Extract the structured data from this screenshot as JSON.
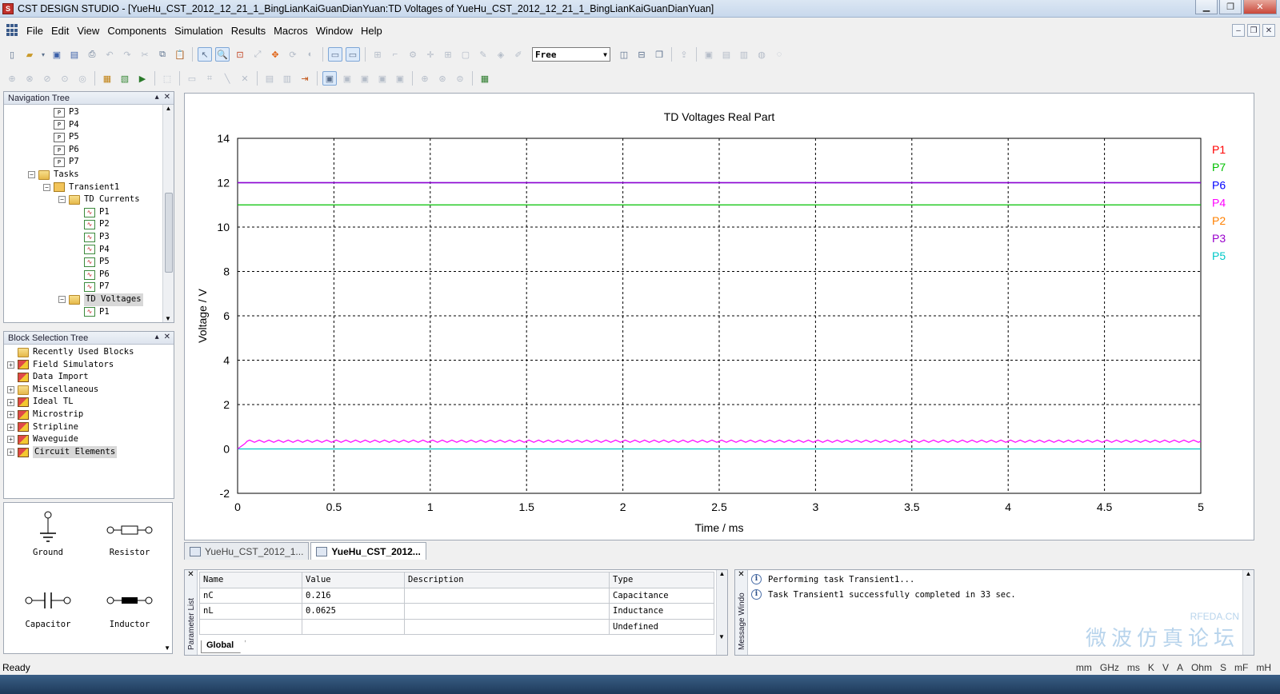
{
  "window": {
    "title": "CST DESIGN STUDIO - [YueHu_CST_2012_12_21_1_BingLianKaiGuanDianYuan:TD Voltages of YueHu_CST_2012_12_21_1_BingLianKaiGuanDianYuan]",
    "app_icon_label": "S"
  },
  "menu": {
    "items": [
      "File",
      "Edit",
      "View",
      "Components",
      "Simulation",
      "Results",
      "Macros",
      "Window",
      "Help"
    ]
  },
  "toolbar": {
    "select_value": "Free"
  },
  "navigation_tree": {
    "title": "Navigation Tree",
    "rows": [
      {
        "indent": 1,
        "icon": "port",
        "label": "P3"
      },
      {
        "indent": 1,
        "icon": "port",
        "label": "P4"
      },
      {
        "indent": 1,
        "icon": "port",
        "label": "P5"
      },
      {
        "indent": 1,
        "icon": "port",
        "label": "P6"
      },
      {
        "indent": 1,
        "icon": "port",
        "label": "P7"
      },
      {
        "indent": 0,
        "icon": "folder",
        "label": "Tasks",
        "expander": "−"
      },
      {
        "indent": 1,
        "icon": "task",
        "label": "Transient1",
        "expander": "−"
      },
      {
        "indent": 2,
        "icon": "folder",
        "label": "TD Currents",
        "expander": "−"
      },
      {
        "indent": 3,
        "icon": "result",
        "label": "P1"
      },
      {
        "indent": 3,
        "icon": "result",
        "label": "P2"
      },
      {
        "indent": 3,
        "icon": "result",
        "label": "P3"
      },
      {
        "indent": 3,
        "icon": "result",
        "label": "P4"
      },
      {
        "indent": 3,
        "icon": "result",
        "label": "P5"
      },
      {
        "indent": 3,
        "icon": "result",
        "label": "P6"
      },
      {
        "indent": 3,
        "icon": "result",
        "label": "P7"
      },
      {
        "indent": 2,
        "icon": "folder",
        "label": "TD Voltages",
        "expander": "−",
        "selected": true
      },
      {
        "indent": 3,
        "icon": "result",
        "label": "P1"
      }
    ]
  },
  "block_selection_tree": {
    "title": "Block Selection Tree",
    "rows": [
      {
        "label": "Recently Used Blocks",
        "icon": "folder",
        "expander": ""
      },
      {
        "label": "Field Simulators",
        "icon": "block",
        "expander": "+"
      },
      {
        "label": "Data Import",
        "icon": "block",
        "expander": ""
      },
      {
        "label": "Miscellaneous",
        "icon": "folder",
        "expander": "+"
      },
      {
        "label": "Ideal TL",
        "icon": "block",
        "expander": "+"
      },
      {
        "label": "Microstrip",
        "icon": "block",
        "expander": "+"
      },
      {
        "label": "Stripline",
        "icon": "block",
        "expander": "+"
      },
      {
        "label": "Waveguide",
        "icon": "block",
        "expander": "+"
      },
      {
        "label": "Circuit Elements",
        "icon": "block",
        "expander": "+",
        "selected": true
      }
    ]
  },
  "components": {
    "items": [
      "Ground",
      "Resistor",
      "Capacitor",
      "Inductor"
    ]
  },
  "chart_data": {
    "type": "line",
    "title": "TD Voltages Real Part",
    "xlabel": "Time / ms",
    "ylabel": "Voltage / V",
    "xlim": [
      0,
      5
    ],
    "ylim": [
      -2,
      14
    ],
    "x_ticks": [
      "0",
      "0.5",
      "1",
      "1.5",
      "2",
      "2.5",
      "3",
      "3.5",
      "4",
      "4.5",
      "5"
    ],
    "y_ticks": [
      "-2",
      "0",
      "2",
      "4",
      "6",
      "8",
      "10",
      "12",
      "14"
    ],
    "grid": true,
    "legend_position": "right",
    "series": [
      {
        "name": "P1",
        "color": "#ff0000",
        "x": [
          0,
          5
        ],
        "y": [
          12,
          12
        ]
      },
      {
        "name": "P7",
        "color": "#00c000",
        "x": [
          0,
          5
        ],
        "y": [
          11,
          11
        ]
      },
      {
        "name": "P6",
        "color": "#0000ff",
        "x": [
          0,
          5
        ],
        "y": [
          12,
          12
        ]
      },
      {
        "name": "P4",
        "color": "#ff00ff",
        "x": [
          0,
          0.05,
          0.1,
          5
        ],
        "y": [
          0,
          0.3,
          0.35,
          0.35
        ]
      },
      {
        "name": "P2",
        "color": "#ff8000",
        "x": [
          0,
          5
        ],
        "y": [
          12,
          12
        ]
      },
      {
        "name": "P3",
        "color": "#9900cc",
        "x": [
          0,
          5
        ],
        "y": [
          12,
          12
        ]
      },
      {
        "name": "P5",
        "color": "#00c8c8",
        "x": [
          0,
          5
        ],
        "y": [
          0,
          0
        ]
      }
    ]
  },
  "doc_tabs": {
    "items": [
      {
        "label": "YueHu_CST_2012_1...",
        "active": false
      },
      {
        "label": "YueHu_CST_2012...",
        "active": true
      }
    ]
  },
  "parameter_list": {
    "side_label": "Parameter List",
    "columns": [
      "Name",
      "Value",
      "Description",
      "Type"
    ],
    "rows": [
      [
        "nC",
        "0.216",
        "",
        "Capacitance"
      ],
      [
        "nL",
        "0.0625",
        "",
        "Inductance"
      ],
      [
        "",
        "",
        "",
        "Undefined"
      ]
    ],
    "tab_label": "Global"
  },
  "message_window": {
    "side_label": "Message Windo",
    "messages": [
      "Performing task Transient1...",
      "Task Transient1 successfully completed in 33 sec."
    ],
    "watermark_small": "RFEDA.CN",
    "watermark_large": "微波仿真论坛"
  },
  "statusbar": {
    "ready": "Ready",
    "units": [
      "mm",
      "GHz",
      "ms",
      "K",
      "V",
      "A",
      "Ohm",
      "S",
      "mF",
      "mH"
    ]
  }
}
